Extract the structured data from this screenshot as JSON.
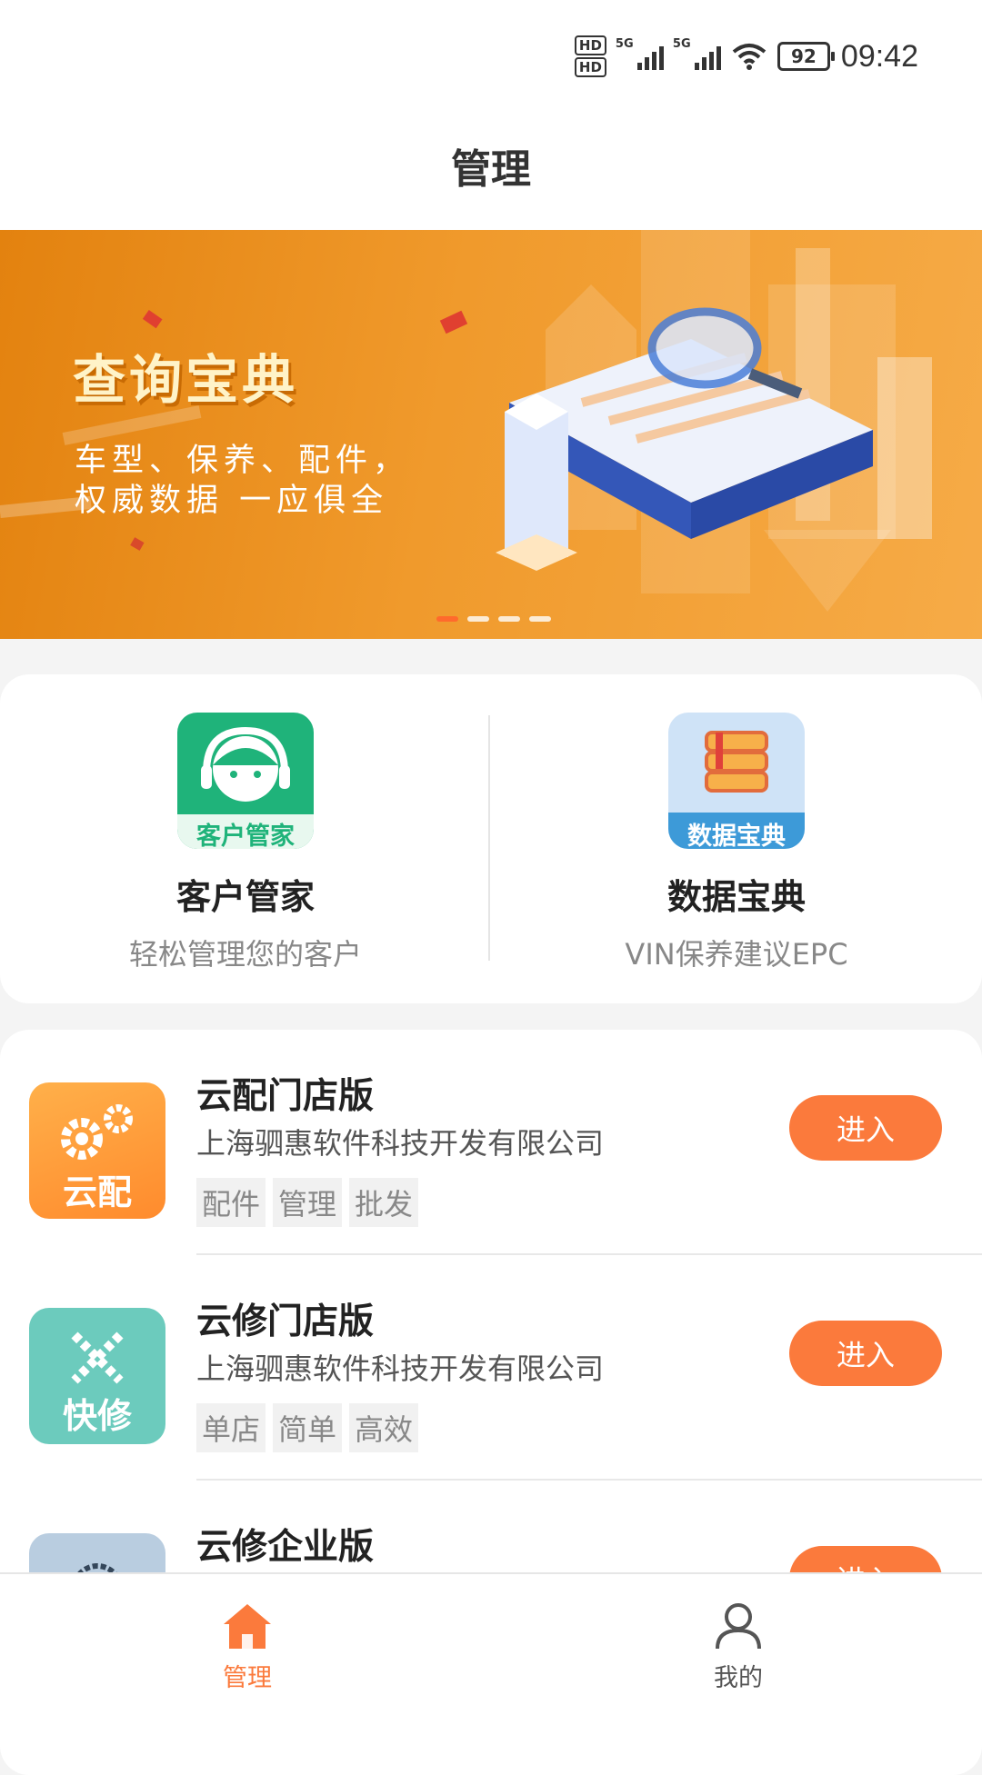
{
  "status_bar": {
    "time": "09:42",
    "battery": "92",
    "network": "5G"
  },
  "header": {
    "title": "管理"
  },
  "banner": {
    "title": "查询宝典",
    "subtitle_line1": "车型、保养、配件，",
    "subtitle_line2": "权威数据 一应俱全"
  },
  "quick_apps": [
    {
      "name": "客户管家",
      "desc": "轻松管理您的客户",
      "icon_text": "客户管家",
      "icon": "headset-icon",
      "color": "#1fb37a"
    },
    {
      "name": "数据宝典",
      "desc": "VIN保养建议EPC",
      "icon_text": "数据宝典",
      "icon": "books-icon",
      "color": "#3d9ad8"
    }
  ],
  "apps": [
    {
      "title": "云配门店版",
      "company": "上海驷惠软件科技开发有限公司",
      "tags": [
        "配件",
        "管理",
        "批发"
      ],
      "button": "进入",
      "icon_text": "云配",
      "icon": "gears-icon"
    },
    {
      "title": "云修门店版",
      "company": "上海驷惠软件科技开发有限公司",
      "tags": [
        "单店",
        "简单",
        "高效"
      ],
      "button": "进入",
      "icon_text": "快修",
      "icon": "wrench-icon"
    },
    {
      "title": "云修企业版",
      "button": "进入",
      "icon": "gear-icon"
    }
  ],
  "tabs": [
    {
      "label": "管理",
      "icon": "home-icon",
      "active": true
    },
    {
      "label": "我的",
      "icon": "user-icon",
      "active": false
    }
  ],
  "colors": {
    "accent": "#fb7a3c",
    "banner": "#f09a2c"
  }
}
